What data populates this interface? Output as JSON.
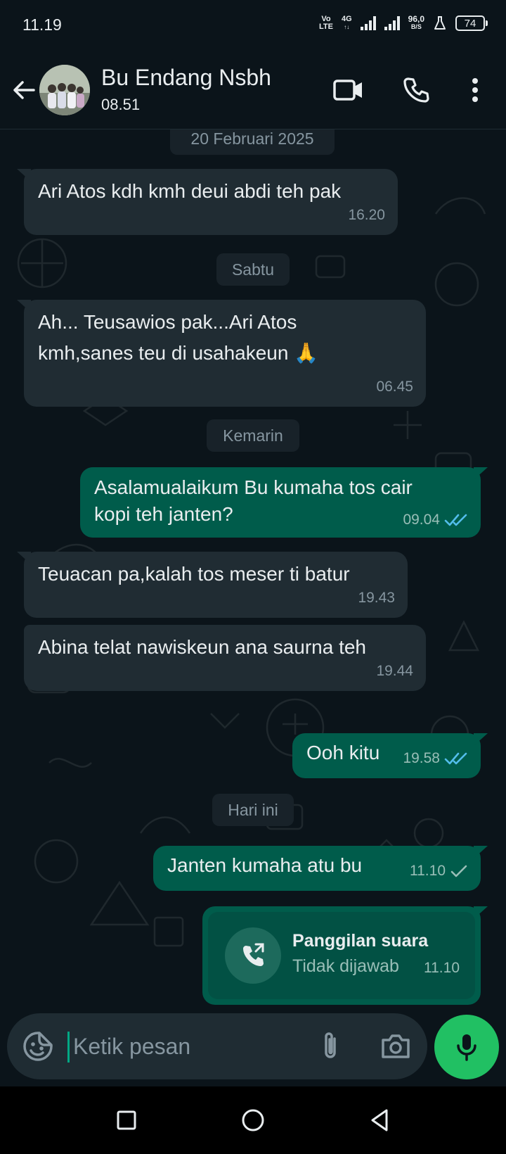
{
  "status_bar": {
    "time": "11.19",
    "volte_top": "Vo",
    "volte_bottom": "LTE",
    "network_top": "4G",
    "network_bottom": "↑↓",
    "speed_top": "96,0",
    "speed_bottom": "B/S",
    "battery": "74"
  },
  "header": {
    "contact_name": "Bu Endang Nsbh",
    "last_seen": "08.51",
    "icons": [
      "back-arrow-icon",
      "video-call-icon",
      "voice-call-icon",
      "more-options-icon"
    ]
  },
  "chat": {
    "date_chips": {
      "feb20": "20 Februari 2025",
      "sabtu": "Sabtu",
      "kemarin": "Kemarin",
      "hari_ini": "Hari ini"
    },
    "messages": [
      {
        "direction": "in",
        "text": "Ari Atos kdh kmh deui abdi teh pak",
        "time": "16.20"
      },
      {
        "direction": "in",
        "line1": "Ah... Teusawios pak...Ari Atos",
        "line2": "kmh,sanes teu di usahakeun 🙏",
        "time": "06.45"
      },
      {
        "direction": "out",
        "line1": "Asalamualaikum Bu kumaha tos cair",
        "line2": "kopi teh janten?",
        "time": "09.04",
        "status": "read"
      },
      {
        "direction": "in",
        "text": "Teuacan pa,kalah tos meser ti batur",
        "time": "19.43"
      },
      {
        "direction": "in",
        "text": "Abina telat nawiskeun ana saurna teh",
        "time": "19.44"
      },
      {
        "direction": "out",
        "text": "Ooh kitu",
        "time": "19.58",
        "status": "read"
      },
      {
        "direction": "out",
        "text": "Janten kumaha atu bu",
        "time": "11.10",
        "status": "sent"
      }
    ],
    "call": {
      "title": "Panggilan suara",
      "subtitle": "Tidak dijawab",
      "time": "11.10"
    }
  },
  "composer": {
    "placeholder": "Ketik pesan"
  },
  "colors": {
    "background": "#0b141a",
    "incoming": "#202c33",
    "outgoing": "#005c4b",
    "accent": "#21c063",
    "read_tick": "#53bdeb"
  }
}
